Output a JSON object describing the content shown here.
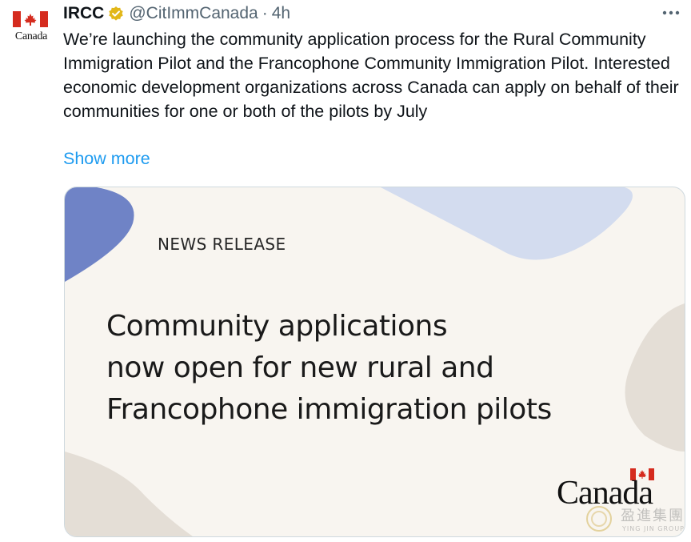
{
  "account": {
    "avatar_word": "Canada",
    "name": "IRCC",
    "handle": "@CitImmCanada",
    "separator": "·",
    "time": "4h"
  },
  "tweet": {
    "text": "We’re launching the community application process for the Rural Community Immigration Pilot and the Francophone Community Immigration Pilot. Interested economic development organizations across Canada can apply on behalf of their communities for one or both of the pilots by July",
    "show_more": "Show more"
  },
  "card": {
    "label": "NEWS RELEASE",
    "headline": [
      "Community applications",
      "now open for new rural and",
      "Francophone immigration pilots"
    ],
    "wordmark": "Canada"
  },
  "watermark": {
    "cn": "盈進集團",
    "en": "YING JIN GROUP"
  },
  "colors": {
    "flag_red": "#d52b1e",
    "link_blue": "#1d9bf0",
    "verified_gold": "#e2b719",
    "card_bg": "#f8f5f0",
    "shape_blue": "#6f83c6",
    "shape_lightblue": "#d3dcef",
    "shape_beige": "#e4ded6"
  },
  "icons": {
    "verified": "verified-badge-icon",
    "more": "more-horizontal-icon"
  }
}
